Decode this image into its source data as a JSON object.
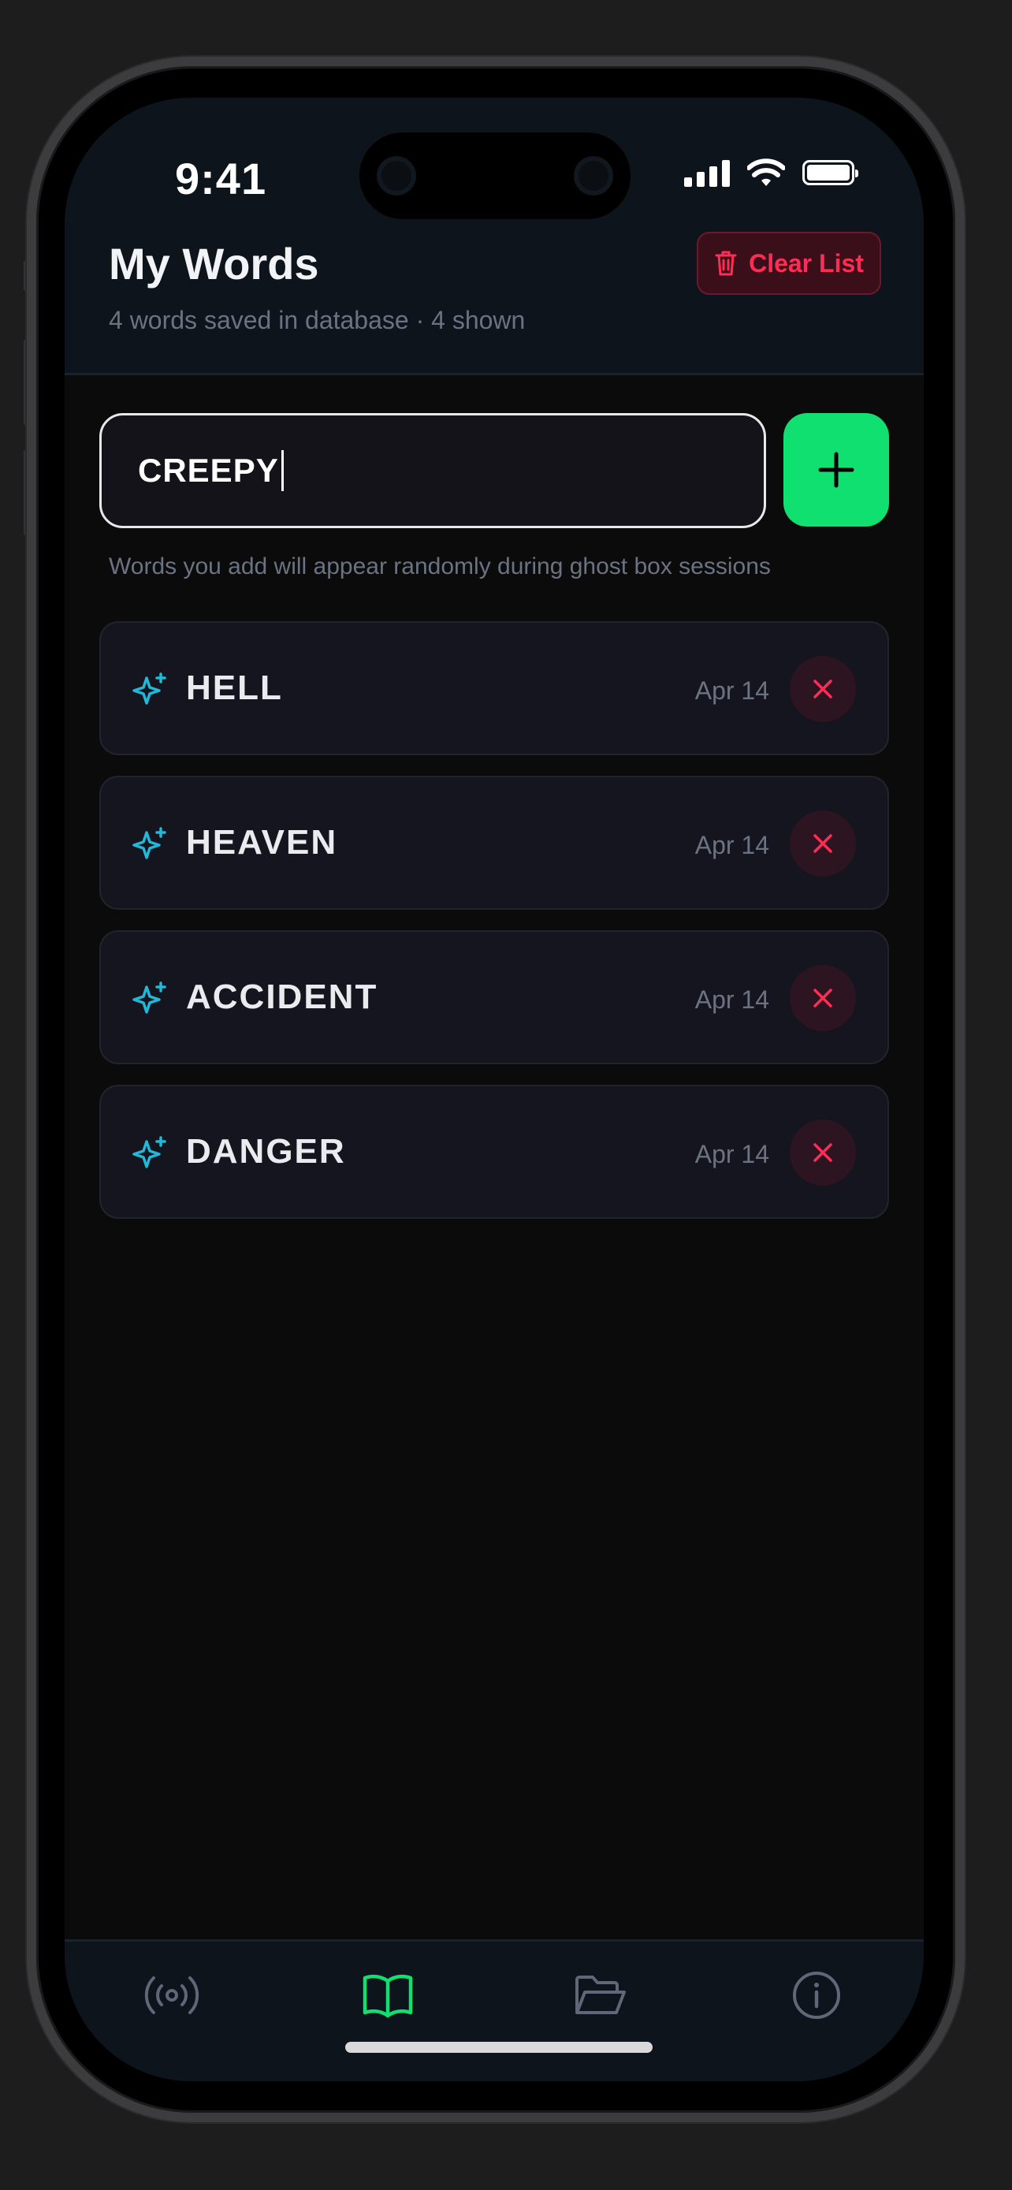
{
  "status_bar": {
    "time": "9:41"
  },
  "header": {
    "title": "My Words",
    "subtitle": "4 words saved in database · 4 shown",
    "clear_label": "Clear List"
  },
  "input": {
    "value": "CREEPY"
  },
  "hint": "Words you add will appear randomly during ghost box sessions",
  "words": [
    {
      "word": "HELL",
      "date": "Apr 14"
    },
    {
      "word": "HEAVEN",
      "date": "Apr 14"
    },
    {
      "word": "ACCIDENT",
      "date": "Apr 14"
    },
    {
      "word": "DANGER",
      "date": "Apr 14"
    }
  ],
  "tabs": [
    {
      "icon": "radio-broadcast-icon",
      "active": false
    },
    {
      "icon": "open-book-icon",
      "active": true
    },
    {
      "icon": "folder-open-icon",
      "active": false
    },
    {
      "icon": "info-icon",
      "active": false
    }
  ],
  "colors": {
    "accent_green": "#10e070",
    "danger_red": "#ff2d55",
    "sparkle_cyan": "#22b8d8",
    "inactive_icon": "#5f6778"
  }
}
